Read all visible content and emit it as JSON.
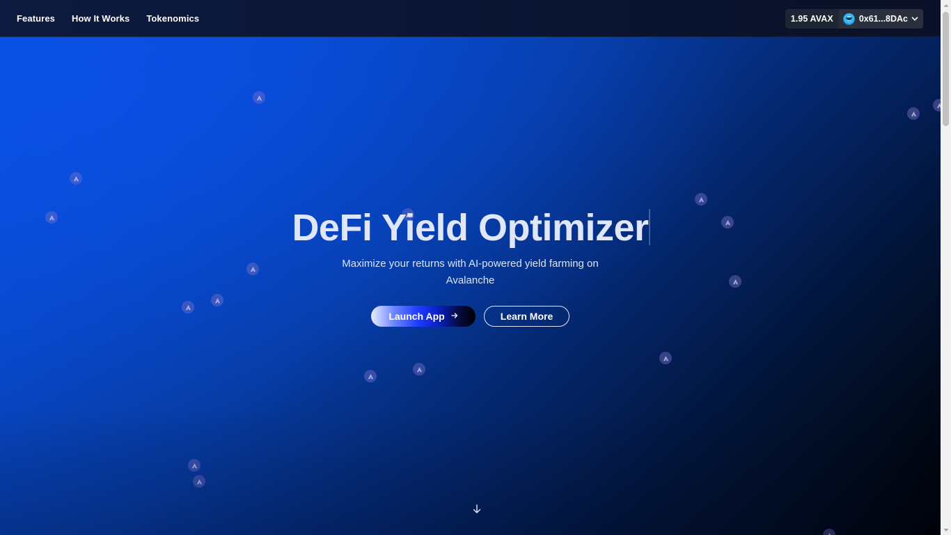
{
  "nav": {
    "links": [
      "Features",
      "How It Works",
      "Tokenomics"
    ]
  },
  "wallet": {
    "balance": "1.95 AVAX",
    "address": "0x61...8DAc"
  },
  "hero": {
    "title": "DeFi Yield Optimizer",
    "subtitle": "Maximize your returns with AI-powered yield farming on Avalanche",
    "launch_label": "Launch App",
    "learn_label": "Learn More"
  },
  "icons": {
    "floating_token": "avalanche-token-icon",
    "scroll": "arrow-down-icon",
    "launch_arrow": "arrow-right-icon",
    "chevron": "chevron-down-icon"
  },
  "colors": {
    "accent": "#0650df",
    "nav_bg": "#0d1a3f"
  }
}
